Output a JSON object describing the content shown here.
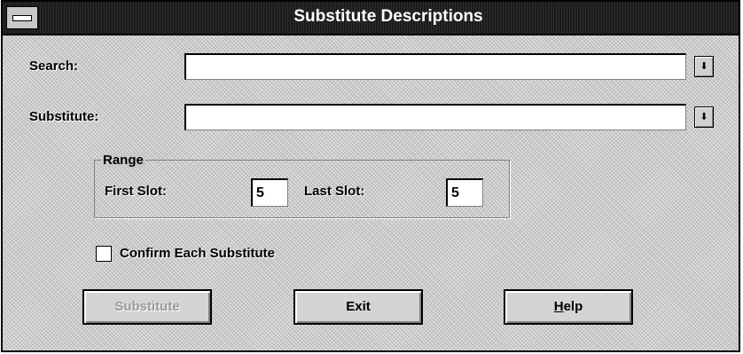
{
  "window": {
    "title": "Substitute Descriptions"
  },
  "fields": {
    "search": {
      "label": "Search:",
      "value": "",
      "dropdown_icon": "down-arrow-icon"
    },
    "substitute": {
      "label": "Substitute:",
      "value": "",
      "dropdown_icon": "down-arrow-icon"
    }
  },
  "range": {
    "title": "Range",
    "first_slot": {
      "label": "First Slot:",
      "value": "5"
    },
    "last_slot": {
      "label": "Last Slot:",
      "value": "5"
    }
  },
  "confirm": {
    "label": "Confirm Each Substitute",
    "checked": false
  },
  "buttons": {
    "substitute": {
      "label": "Substitute",
      "enabled": false
    },
    "exit": {
      "label": "Exit"
    },
    "help": {
      "label_mnemonic": "H",
      "label_rest": "elp"
    }
  }
}
